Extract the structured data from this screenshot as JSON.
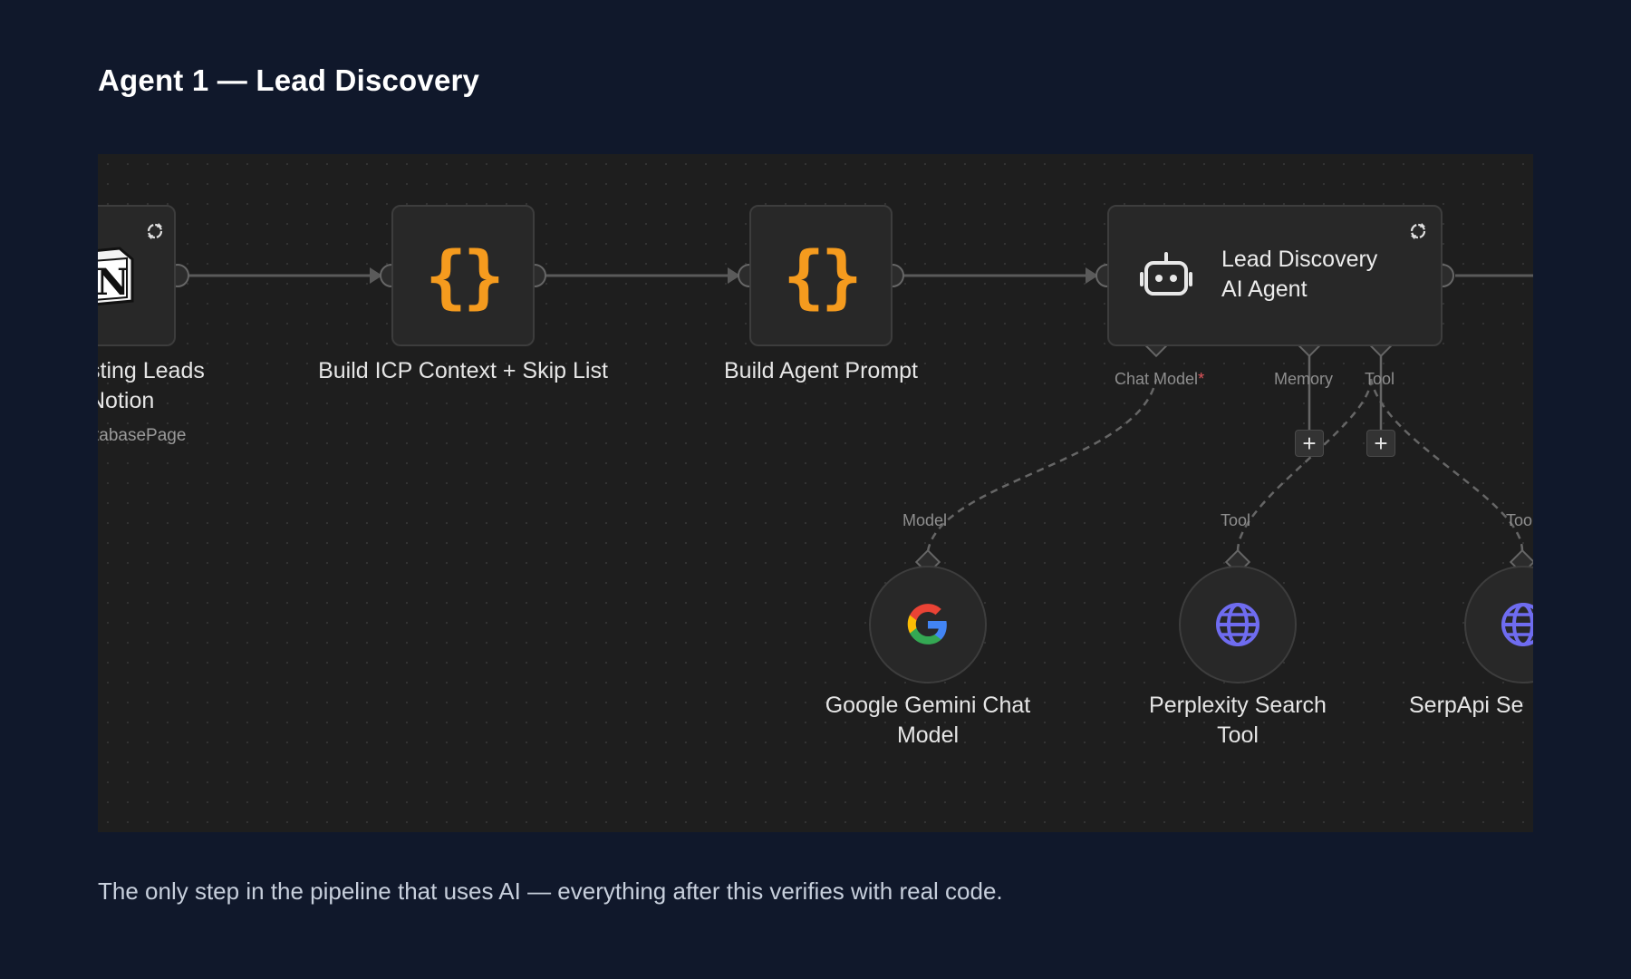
{
  "page": {
    "title": "Agent 1 — Lead Discovery",
    "caption": "The only step in the pipeline that uses AI — everything after this verifies with real code."
  },
  "workflow": {
    "nodes": [
      {
        "id": "notion",
        "label_line1": "sting Leads",
        "label_line2": "Notion",
        "subtitle": "tabasePage",
        "icon": "notion-icon"
      },
      {
        "id": "build-icp",
        "label": "Build ICP Context + Skip List",
        "icon": "braces-icon"
      },
      {
        "id": "build-prompt",
        "label": "Build Agent Prompt",
        "icon": "braces-icon"
      },
      {
        "id": "agent",
        "label_line1": "Lead Discovery",
        "label_line2": "AI Agent",
        "icon": "robot-icon"
      },
      {
        "id": "gemini",
        "label": "Google Gemini Chat Model",
        "icon": "google-icon"
      },
      {
        "id": "perplexity",
        "label": "Perplexity Search Tool",
        "icon": "globe-icon"
      },
      {
        "id": "serpapi",
        "label": "SerpApi Se",
        "icon": "globe-icon"
      }
    ],
    "agent_ports": {
      "chat_model": "Chat Model",
      "required_mark": "*",
      "memory": "Memory",
      "tool": "Tool"
    },
    "sub_ports": {
      "model": "Model",
      "tool": "Tool",
      "tool_cut": "Too"
    },
    "add_button": "+"
  },
  "colors": {
    "background": "#10182b",
    "canvas": "#1e1e1e",
    "node": "#282828",
    "brace": "#f59b1e",
    "globe": "#6f6cf0",
    "required": "#e0545a"
  }
}
